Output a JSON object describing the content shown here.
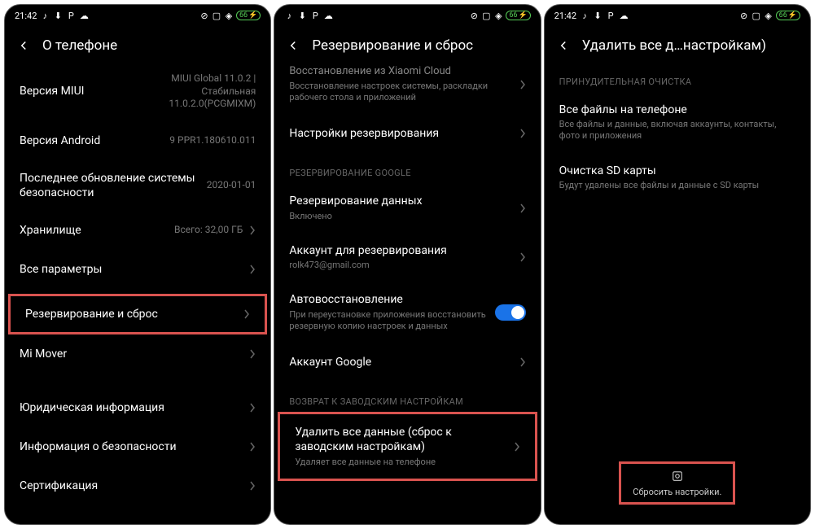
{
  "status": {
    "time": "21:42",
    "battery": "66"
  },
  "screen1": {
    "title": "О телефоне",
    "rows": {
      "miui": {
        "label": "Версия MIUI",
        "value": "MIUI Global 11.0.2 | Стабильная 11.0.2.0(PCGMIXM)"
      },
      "android": {
        "label": "Версия Android",
        "value": "9 PPR1.180610.011"
      },
      "security": {
        "label": "Последнее обновление системы безопасности",
        "value": "2020-01-01"
      },
      "storage": {
        "label": "Хранилище",
        "value": "Всего: 32,00 ГБ"
      },
      "allparams": {
        "label": "Все параметры"
      },
      "backup": {
        "label": "Резервирование и сброс"
      },
      "mimover": {
        "label": "Mi Mover"
      },
      "legal": {
        "label": "Юридическая информация"
      },
      "secinfo": {
        "label": "Информация о безопасности"
      },
      "cert": {
        "label": "Сертификация"
      }
    }
  },
  "screen2": {
    "title": "Резервирование и сброс",
    "cloud": {
      "label": "Восстановление из Xiaomi Cloud",
      "sub": "Восстановление настроек системы, раскладки рабочего стола и приложений"
    },
    "backup_settings": {
      "label": "Настройки резервирования"
    },
    "section_google": "РЕЗЕРВИРОВАНИЕ GOOGLE",
    "data_backup": {
      "label": "Резервирование данных",
      "sub": "Включено"
    },
    "account_backup": {
      "label": "Аккаунт для резервирования",
      "sub": "rolk473@gmail.com"
    },
    "autorestore": {
      "label": "Автовосстановление",
      "sub": "При переустановке приложения восстановить резервную копию настроек и данных"
    },
    "google_acc": {
      "label": "Аккаунт Google"
    },
    "section_factory": "ВОЗВРАТ К ЗАВОДСКИМ НАСТРОЙКАМ",
    "erase": {
      "label": "Удалить все данные (сброс к заводским настройкам)",
      "sub": "Удаляет все данные на телефоне"
    }
  },
  "screen3": {
    "title": "Удалить все д…настройкам)",
    "section_force": "ПРИНУДИТЕЛЬНАЯ ОЧИСТКА",
    "all_files": {
      "label": "Все файлы на телефоне",
      "sub": "Все файлы и данные, включая аккаунты, контакты, фото и приложения"
    },
    "sd": {
      "label": "Очистка SD карты",
      "sub": "Будут удалены все файлы и данные с SD карты"
    },
    "reset_btn": "Сбросить настройки."
  }
}
